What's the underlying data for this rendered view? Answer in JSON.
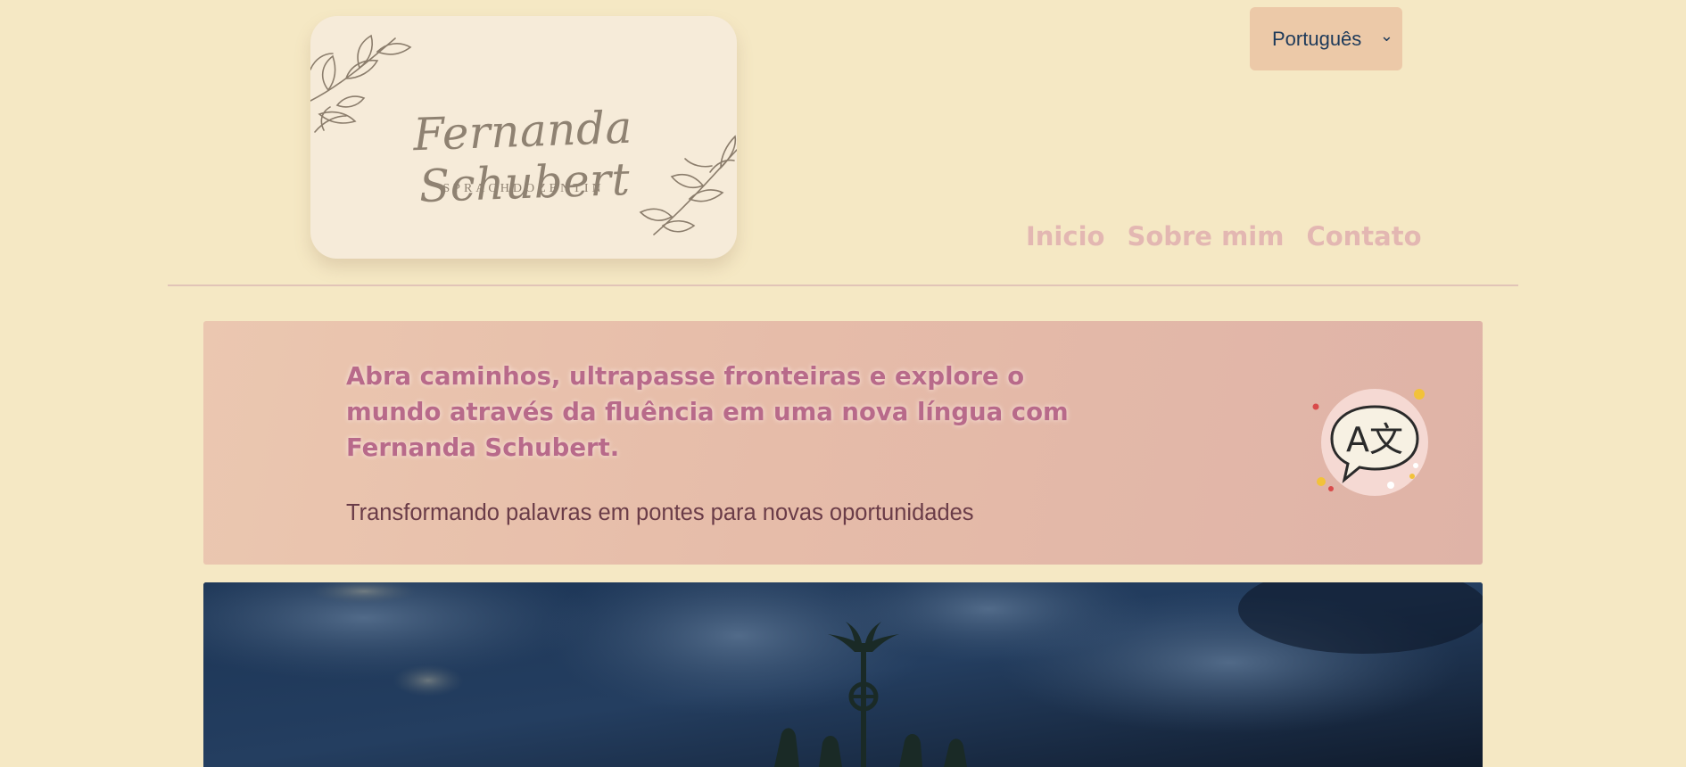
{
  "logo": {
    "name": "Fernanda Schubert",
    "subtitle": "SPRACHDOZENTIN"
  },
  "language_select": {
    "selected": "Português"
  },
  "nav": {
    "items": [
      {
        "label": "Inicio"
      },
      {
        "label": "Sobre mim"
      },
      {
        "label": "Contato"
      }
    ]
  },
  "hero": {
    "title": "Abra caminhos, ultrapasse fronteiras e explore o mundo através da fluência em uma nova língua com Fernanda Schubert.",
    "subtitle": "Transformando palavras em pontes para novas oportunidades",
    "icon": "translate-icon",
    "icon_glyphs": "A文"
  },
  "photo": {
    "icon": "brandenburg-gate-quadriga-photo"
  },
  "colors": {
    "page_bg": "#f5e8c4",
    "nav_text": "#e3b7b2",
    "hero_title": "#b86a8a",
    "hero_subtitle": "#6a3c48",
    "select_bg": "#ecc9a8",
    "select_text": "#1e3a5a"
  }
}
